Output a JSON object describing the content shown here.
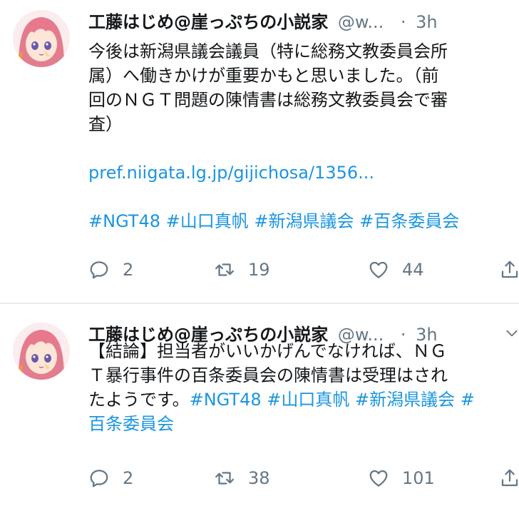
{
  "tweets": [
    {
      "display_name": "工藤はじめ@崖っぷちの小説家",
      "handle": "@w...",
      "separator": "·",
      "time": "3h",
      "text_lines": [
        "今後は新潟県議会議員（特に総務文教委員会所",
        "属）へ働きかけが重要かもと思いました。（前",
        "回のＮＧＴ問題の陳情書は総務文教委員会で審",
        "査）"
      ],
      "link": "pref.niigata.lg.jp/gijichosa/1356...",
      "hashtags": [
        "#NGT48",
        "#山口真帆",
        "#新潟県議会",
        "#百条委員会"
      ],
      "replies": "2",
      "retweets": "19",
      "likes": "44"
    },
    {
      "display_name": "工藤はじめ@崖っぷちの小説家",
      "handle": "@w...",
      "separator": "·",
      "time": "3h",
      "text_lines": [
        "【結論】担当者がいいかげんでなければ、ＮＧ",
        "Ｔ暴行事件の百条委員会の陳情書は受理はされ",
        "たようです。"
      ],
      "inline_hashtags": [
        "#NGT48",
        "#山口真帆",
        "#新潟県議会",
        "#"
      ],
      "wrapped_hashtag": "百条委員会",
      "replies": "2",
      "retweets": "38",
      "likes": "101"
    }
  ],
  "icons": {
    "avatar": "anime-avatar",
    "reply": "reply-icon",
    "retweet": "retweet-icon",
    "like": "like-icon",
    "share": "share-icon",
    "more": "chevron-down-icon"
  },
  "colors": {
    "link": "#1b95e0",
    "secondary": "#657786",
    "text": "#14171a",
    "divider": "#e6ecf0"
  }
}
